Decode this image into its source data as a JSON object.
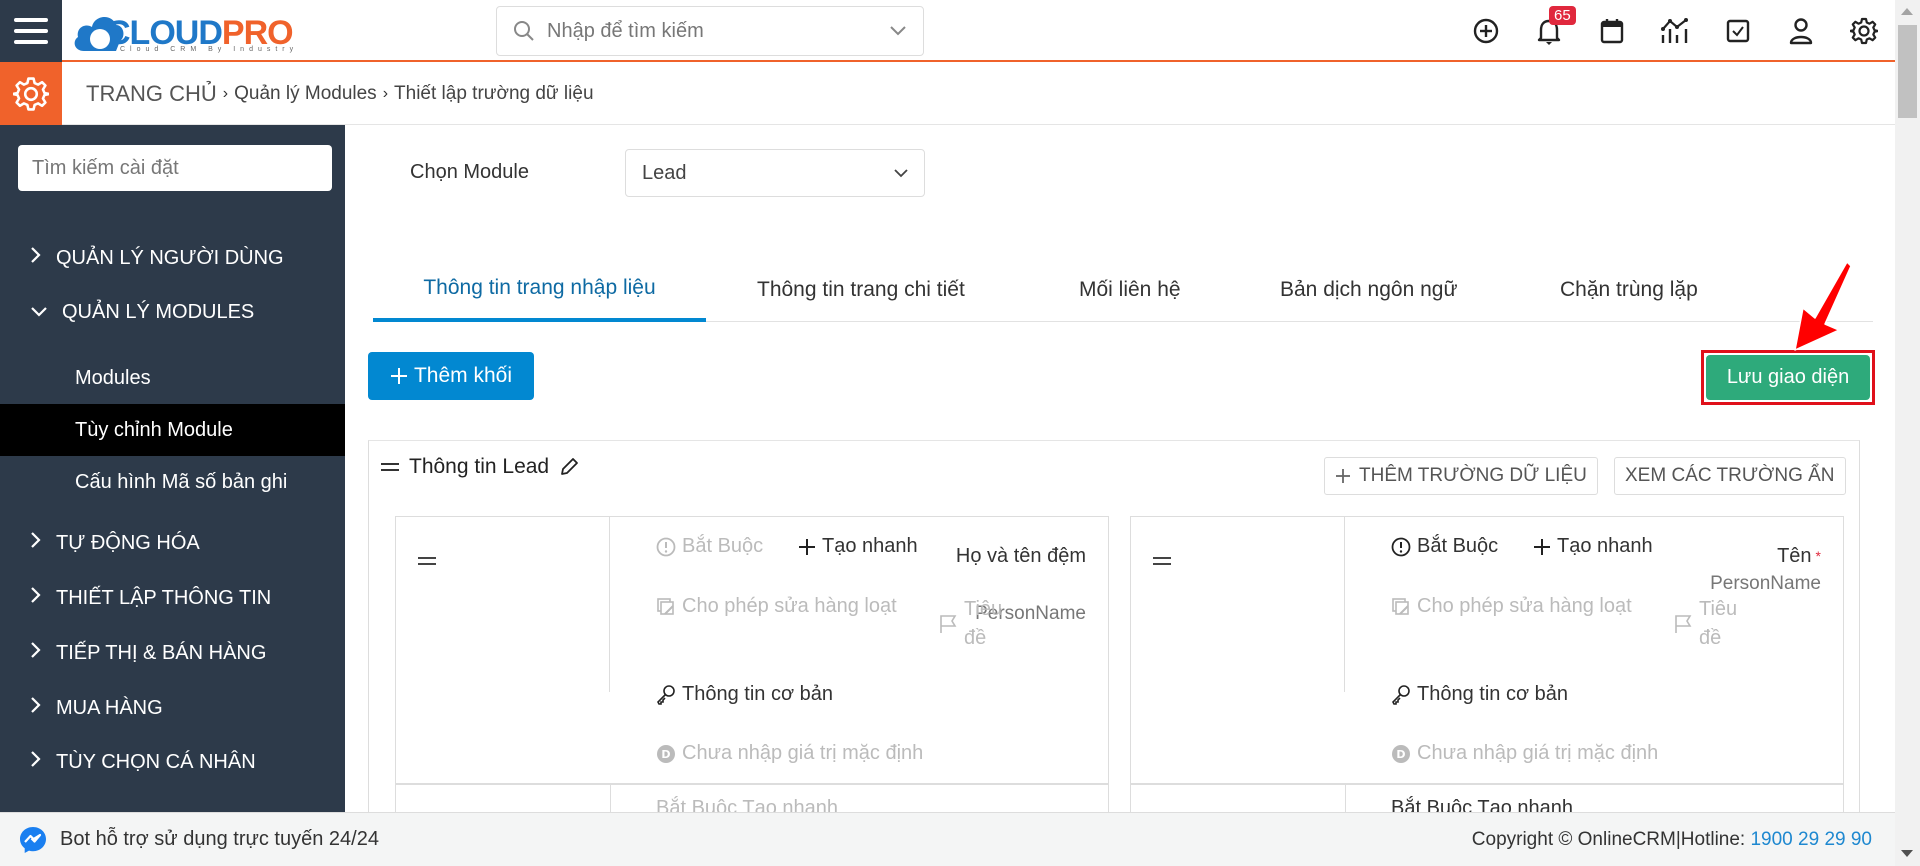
{
  "header": {
    "logo_text_a": "CLOUD",
    "logo_text_b": "PRO",
    "logo_tagline": "Cloud CRM By Industry",
    "search_placeholder": "Nhập để tìm kiếm",
    "notification_count": "65",
    "icons": [
      "plus-circle-icon",
      "bell-icon",
      "calendar-icon",
      "chart-icon",
      "checkbox-icon",
      "user-icon",
      "gear-icon"
    ]
  },
  "breadcrumb": {
    "home": "TRANG CHỦ",
    "items": [
      "Quản lý Modules",
      "Thiết lập trường dữ liệu"
    ]
  },
  "sidebar": {
    "search_placeholder": "Tìm kiếm cài đặt",
    "groups": [
      {
        "label": "QUẢN LÝ NGƯỜI DÙNG",
        "expanded": false
      },
      {
        "label": "QUẢN LÝ MODULES",
        "expanded": true,
        "items": [
          {
            "label": "Modules",
            "active": false
          },
          {
            "label": "Tùy chỉnh Module",
            "active": true
          },
          {
            "label": "Cấu hình Mã số bản ghi",
            "active": false
          }
        ]
      },
      {
        "label": "TỰ ĐỘNG HÓA",
        "expanded": false
      },
      {
        "label": "THIẾT LẬP THÔNG TIN",
        "expanded": false
      },
      {
        "label": "TIẾP THỊ & BÁN HÀNG",
        "expanded": false
      },
      {
        "label": "MUA HÀNG",
        "expanded": false
      },
      {
        "label": "TÙY CHỌN CÁ NHÂN",
        "expanded": false
      }
    ]
  },
  "main": {
    "module_label": "Chọn Module",
    "module_value": "Lead",
    "tabs": [
      {
        "label": "Thông tin trang nhập liệu",
        "active": true
      },
      {
        "label": "Thông tin trang chi tiết",
        "active": false
      },
      {
        "label": "Mối liên hệ",
        "active": false
      },
      {
        "label": "Bản dịch ngôn ngữ",
        "active": false
      },
      {
        "label": "Chặn trùng lặp",
        "active": false
      }
    ],
    "add_block_label": "Thêm khối",
    "save_layout_label": "Lưu giao diện",
    "block": {
      "title": "Thông tin Lead",
      "add_field_label": "THÊM TRƯỜNG DỮ LIỆU",
      "show_hidden_label": "XEM CÁC TRƯỜNG ẨN",
      "fields": [
        {
          "name": "Họ và tên đệm",
          "type": "PersonName",
          "required": false,
          "opt_required": "Bắt Buộc",
          "opt_quick_create": "Tạo nhanh",
          "opt_mass_edit": "Cho phép sửa hàng loạt",
          "opt_title": "Tiêu đề",
          "opt_block": "Thông tin cơ bản",
          "opt_default": "Chưa nhập giá trị mặc định"
        },
        {
          "name": "Tên",
          "type": "PersonName",
          "required": true,
          "opt_required": "Bắt Buộc",
          "opt_quick_create": "Tạo nhanh",
          "opt_mass_edit": "Cho phép sửa hàng loạt",
          "opt_title": "Tiêu đề",
          "opt_block": "Thông tin cơ bản",
          "opt_default": "Chưa nhập giá trị mặc định"
        }
      ],
      "next_row_partial": "Bắt Buộc   Tạo nhanh"
    }
  },
  "footer": {
    "bot_text": "Bot hỗ trợ sử dụng trực tuyến 24/24",
    "copyright": "Copyright © OnlineCRM|Hotline: ",
    "hotline": "1900 29 29 90"
  },
  "colors": {
    "accent_orange": "#f0622b",
    "sidebar_bg": "#2d3a4a",
    "primary_blue": "#0288d1",
    "save_green": "#2eaa7b",
    "highlight_red": "#e0101a",
    "badge_red": "#e0283d"
  }
}
